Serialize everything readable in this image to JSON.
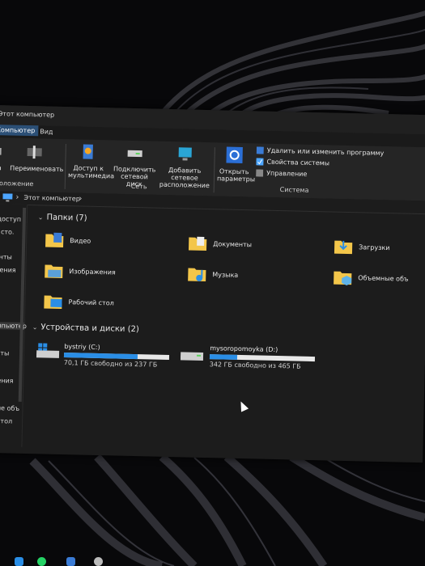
{
  "window": {
    "title": "Этот компьютер"
  },
  "tabs": [
    "Компьютер",
    "Вид"
  ],
  "ribbon": {
    "location_group": {
      "properties_partial": "а",
      "rename": "Переименовать",
      "group_label": "положение"
    },
    "network_group": {
      "media_access": "Доступ к мультимедиа",
      "map_drive": "Подключить сетевой диск",
      "add_location": "Добавить сетевое расположение",
      "group_label": "Сеть"
    },
    "system_group": {
      "open_settings": "Открыть параметры",
      "uninstall": "Удалить или изменить программу",
      "system_properties": "Свойства системы",
      "manage": "Управление",
      "group_label": "Система"
    }
  },
  "address": {
    "path": "Этот компьютер"
  },
  "sidebar": {
    "items": [
      "й доступ",
      "ол сто.",
      "и",
      "менты",
      "ажения",
      "а",
      "компьютер",
      "иенты",
      "ки",
      "ажения",
      "а",
      "мные объ",
      "ий стол"
    ]
  },
  "folders_section": {
    "title": "Папки (7)",
    "items": [
      {
        "label": "Видео"
      },
      {
        "label": "Документы"
      },
      {
        "label": "Загрузки"
      },
      {
        "label": "Изображения"
      },
      {
        "label": "Музыка"
      },
      {
        "label": "Объемные объ"
      },
      {
        "label": "Рабочий стол"
      }
    ]
  },
  "drives_section": {
    "title": "Устройства и диски (2)",
    "drives": [
      {
        "name": "bystriy (C:)",
        "free": "70,1 ГБ свободно из 237 ГБ",
        "used_fraction": 0.7
      },
      {
        "name": "mysoropomoyka (D:)",
        "free": "342 ГБ свободно из 465 ГБ",
        "used_fraction": 0.26
      }
    ]
  },
  "colors": {
    "accent": "#2a8ee6",
    "selected_tab": "#2b4f76",
    "folder": "#f3c64a"
  }
}
